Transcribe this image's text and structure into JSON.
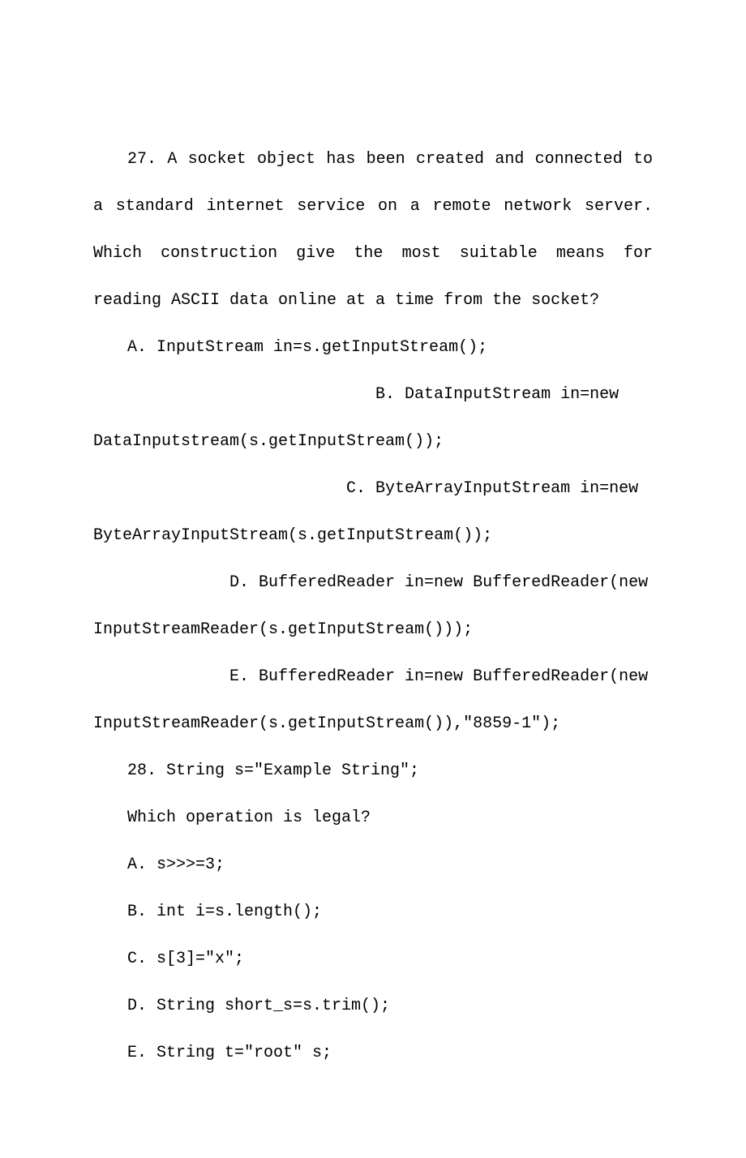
{
  "q27": {
    "stem": "27. A socket object has been created and connected to a standard internet service on a remote network server. Which construction give the most suitable means for reading ASCII data online at a time from the socket?",
    "optA": "A. InputStream in=s.getInputStream();",
    "optB_pre": "B.    DataInputStream    in=new",
    "optB_cont": "DataInputstream(s.getInputStream());",
    "optC_pre": "C.    ByteArrayInputStream    in=new",
    "optC_cont": "ByteArrayInputStream(s.getInputStream());",
    "optD_pre": "D.  BufferedReader  in=new  BufferedReader(new",
    "optD_cont": "InputStreamReader(s.getInputStream()));",
    "optE_pre": "E.  BufferedReader  in=new  BufferedReader(new",
    "optE_cont": "InputStreamReader(s.getInputStream()),\"8859-1\");"
  },
  "q28": {
    "stem": "28. String s=\"Example String\";",
    "subq": "Which operation is legal?",
    "optA": "A. s>>>=3;",
    "optB": "B. int i=s.length();",
    "optC": "C. s[3]=\"x\";",
    "optD": "D. String short_s=s.trim();",
    "optE": "E. String t=\"root\" s;"
  }
}
